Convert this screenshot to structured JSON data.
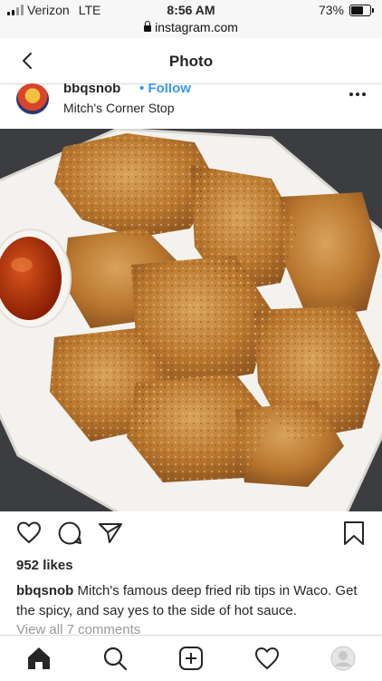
{
  "status_bar": {
    "carrier": "Verizon",
    "network": "LTE",
    "time": "8:56 AM",
    "battery": "73%",
    "battery_level": 0.73
  },
  "url_bar": {
    "url": "instagram.com"
  },
  "nav": {
    "title": "Photo",
    "back_icon": "chevron-left-icon"
  },
  "post": {
    "username": "bbqsnob",
    "separator": "•",
    "follow_label": "Follow",
    "location": "Mitch's Corner Stop",
    "likes": "952 likes",
    "caption_user": "bbqsnob",
    "caption_text": "Mitch's famous deep fried rib tips in Waco. Get the spicy, and say yes to the side of hot sauce.",
    "view_comments": "View all 7 comments"
  },
  "actions": [
    "heart-icon",
    "comment-icon",
    "share-icon",
    "bookmark-icon"
  ],
  "tabs": [
    "home-icon",
    "search-icon",
    "new-post-icon",
    "activity-icon",
    "profile-icon"
  ],
  "colors": {
    "link": "#3897f0",
    "text": "#262626",
    "muted": "#999999"
  }
}
